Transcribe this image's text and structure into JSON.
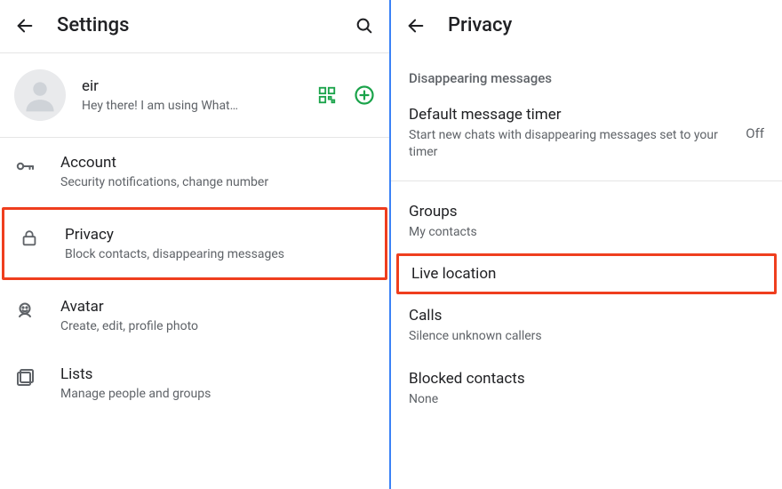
{
  "left": {
    "header": {
      "title": "Settings"
    },
    "profile": {
      "name": "eir",
      "status": "Hey there! I am using What…"
    },
    "items": [
      {
        "title": "Account",
        "sub": "Security notifications, change number"
      },
      {
        "title": "Privacy",
        "sub": "Block contacts, disappearing messages"
      },
      {
        "title": "Avatar",
        "sub": "Create, edit, profile photo"
      },
      {
        "title": "Lists",
        "sub": "Manage people and groups"
      }
    ]
  },
  "right": {
    "header": {
      "title": "Privacy"
    },
    "section_heading": "Disappearing messages",
    "default_timer": {
      "title": "Default message timer",
      "sub": "Start new chats with disappearing messages set to your timer",
      "value": "Off"
    },
    "items": [
      {
        "title": "Groups",
        "sub": "My contacts"
      },
      {
        "title": "Live location",
        "sub": ""
      },
      {
        "title": "Calls",
        "sub": "Silence unknown callers"
      },
      {
        "title": "Blocked contacts",
        "sub": "None"
      }
    ]
  }
}
